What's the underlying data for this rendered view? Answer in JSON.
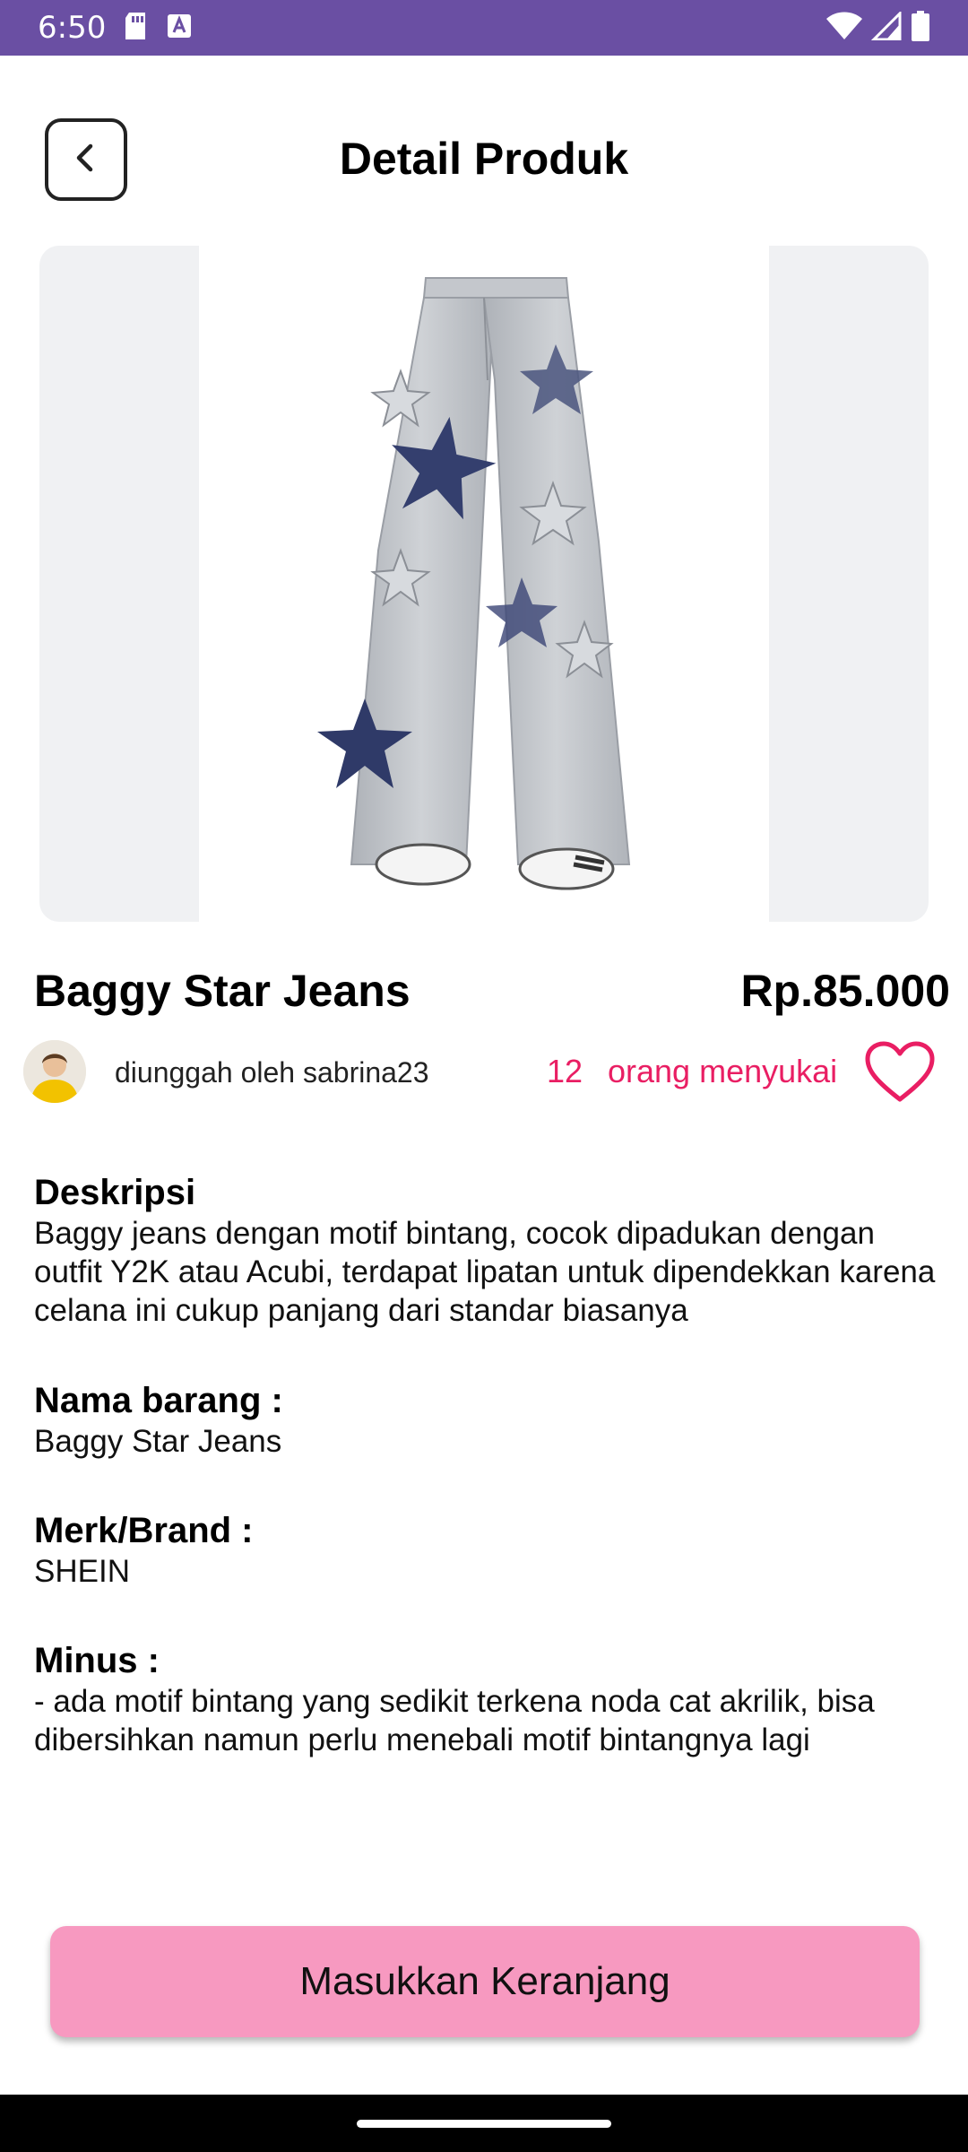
{
  "status_bar": {
    "time": "6:50",
    "icons": [
      "sd-card-icon",
      "a-notification-icon",
      "wifi-icon",
      "signal-icon",
      "battery-icon"
    ],
    "background": "#6a4fa3"
  },
  "header": {
    "title": "Detail Produk",
    "back_icon": "chevron-left-icon"
  },
  "product": {
    "image_description": "jeans-photo",
    "name": "Baggy Star Jeans",
    "price": "Rp.85.000",
    "uploader_text": "diunggah oleh sabrina23",
    "like_count": "12",
    "likes_label": "orang menyukai",
    "accent_color": "#e91e63"
  },
  "details": {
    "description_heading": "Deskripsi",
    "description_text": "Baggy jeans dengan motif bintang, cocok dipadukan dengan outfit Y2K atau Acubi, terdapat lipatan untuk dipendekkan karena celana ini cukup panjang dari standar biasanya",
    "item_name_heading": "Nama barang :",
    "item_name_value": "Baggy Star Jeans",
    "brand_heading": "Merk/Brand :",
    "brand_value": "SHEIN",
    "minus_heading": "Minus :",
    "minus_value": "- ada motif bintang yang sedikit terkena noda cat akrilik, bisa dibersihkan namun perlu menebali motif bintangnya lagi"
  },
  "actions": {
    "cart_label": "Masukkan Keranjang",
    "cart_color": "#f799c0"
  }
}
